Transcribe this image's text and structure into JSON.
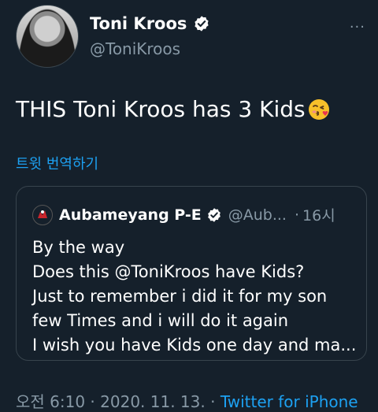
{
  "tweet": {
    "author_name": "Toni Kroos",
    "author_handle": "@ToniKroos",
    "more_label": "···",
    "text": "THIS Toni Kroos has 3 Kids",
    "emoji": "kissing-face-icon",
    "translate_label": "트윗 번역하기",
    "time": "오전 6:10",
    "sep1": " · ",
    "date": "2020. 11. 13.",
    "sep2": " · ",
    "source": "Twitter for iPhone"
  },
  "quoted": {
    "author_name": "Aubameyang P-E",
    "author_handle": "@Aub...",
    "sep": "·",
    "time": "16시",
    "lines": [
      "By the way",
      "Does this @ToniKroos have Kids?",
      "Just to remember i did it for my son",
      "few Times and i will do it again",
      "I wish you have Kids one day and ma..."
    ]
  },
  "colors": {
    "background": "#15202b",
    "accent": "#1da1f2",
    "secondary_text": "#8899a6",
    "border": "#38444d"
  }
}
